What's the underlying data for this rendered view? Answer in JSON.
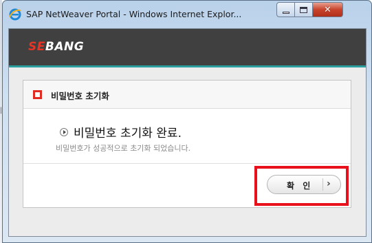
{
  "window": {
    "title": "SAP NetWeaver Portal - Windows Internet Explor...",
    "controls": {
      "minimize_icon": "minimize-icon",
      "maximize_icon": "maximize-icon",
      "close_icon": "close-icon"
    }
  },
  "header": {
    "logo_prefix": "SE",
    "logo_mark": "B",
    "logo_suffix": "ANG",
    "accent_color": "#2b9ea0",
    "bar_color": "#404040"
  },
  "panel": {
    "title": "비밀번호 초기화",
    "title_icon": "square-bullet-icon",
    "message": "비밀번호 초기화 완료.",
    "sub_message": "비밀번호가 성공적으로 초기화 되었습니다.",
    "message_icon": "play-circle-icon"
  },
  "actions": {
    "confirm_label": "확 인",
    "confirm_arrow": "›",
    "highlight_color": "#e8101b"
  }
}
